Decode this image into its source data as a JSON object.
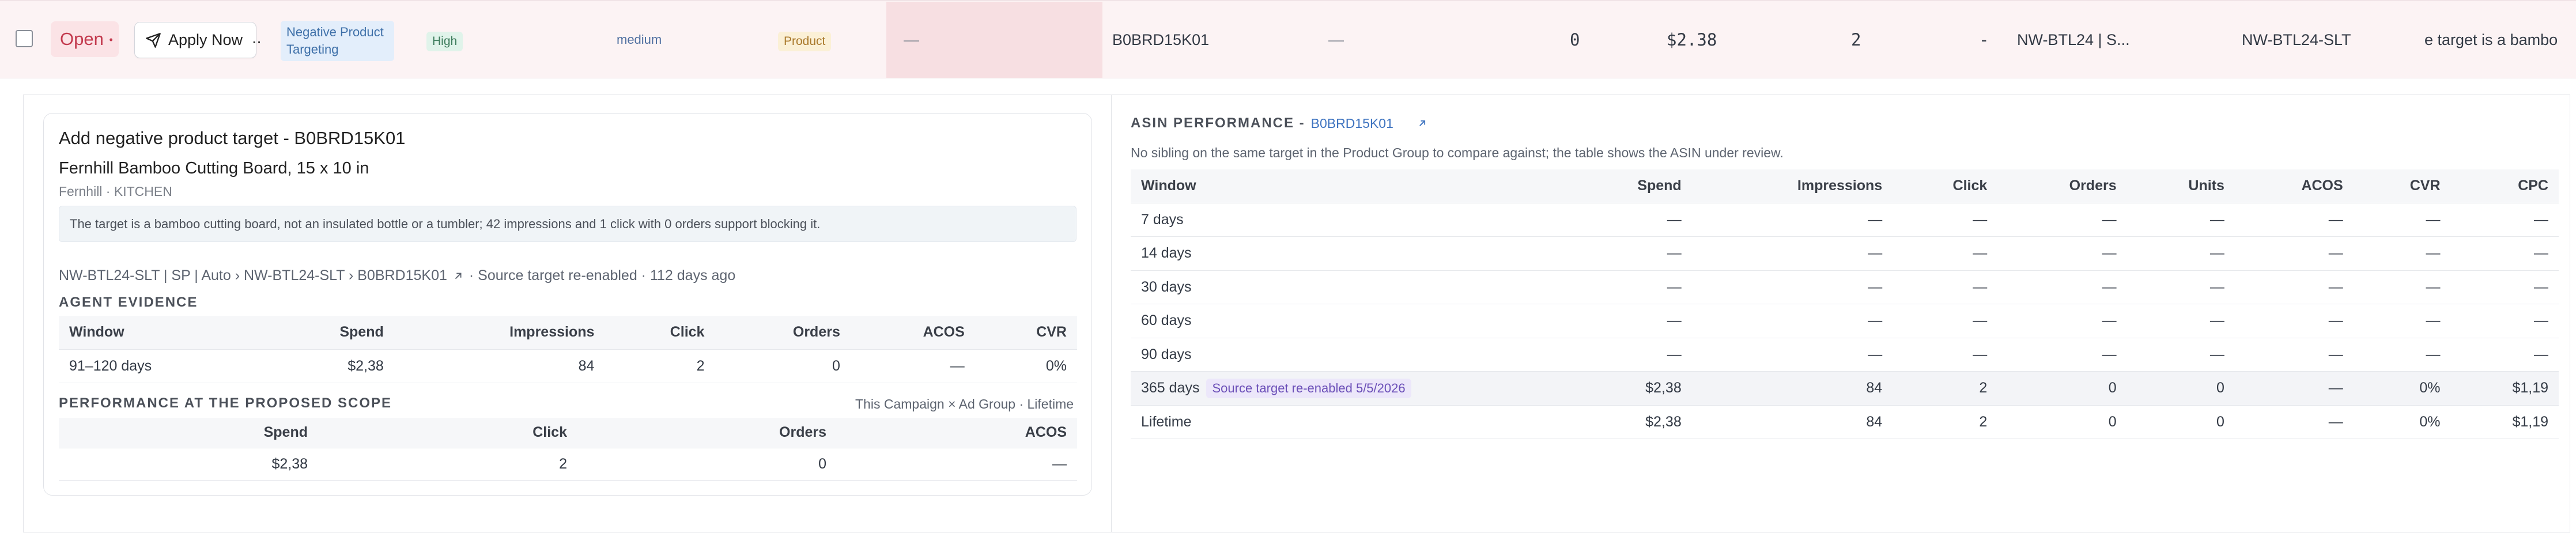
{
  "row": {
    "status": "Open",
    "status_marker": "•",
    "apply_label": "Apply Now",
    "overflow": "..",
    "type_tag": "Negative Product Targeting",
    "priority": "High",
    "confidence": "medium",
    "category": "Product",
    "dash_a": "—",
    "asin": "B0BRD15K01",
    "dash_b": "—",
    "zero": "0",
    "spend": "$2.38",
    "clicks": "2",
    "dash_c": "-",
    "campaign": "NW-BTL24 | S...",
    "ad_group": "NW-BTL24-SLT",
    "reason_clip": "e target is a bambo"
  },
  "card": {
    "title": "Add negative product target - B0BRD15K01",
    "product_name": "Fernhill Bamboo Cutting Board, 15 x 10 in",
    "brand": "Fernhill · KITCHEN",
    "reason": "The target is a bamboo cutting board, not an insulated bottle or a tumbler; 42 impressions and 1 click with 0 orders support blocking it.",
    "breadcrumb": "NW-BTL24-SLT | SP | Auto › NW-BTL24-SLT › B0BRD15K01",
    "breadcrumb_suffix": "· Source target re-enabled · 112 days ago",
    "agent_evidence_label": "AGENT EVIDENCE",
    "evidence": {
      "headers": [
        "Window",
        "Spend",
        "Impressions",
        "Click",
        "Orders",
        "ACOS",
        "CVR"
      ],
      "rows": [
        [
          "91–120 days",
          "$2,38",
          "84",
          "2",
          "0",
          "—",
          "0%"
        ]
      ]
    },
    "scope_label": "PERFORMANCE AT THE PROPOSED SCOPE",
    "scope_note": "This Campaign × Ad Group · Lifetime",
    "scope": {
      "headers": [
        "Spend",
        "Click",
        "Orders",
        "ACOS"
      ],
      "rows": [
        [
          "$2,38",
          "2",
          "0",
          "—"
        ]
      ]
    }
  },
  "asin_panel": {
    "title": "ASIN PERFORMANCE -",
    "asin_link": "B0BRD15K01",
    "note": "No sibling on the same target in the Product Group to compare against; the table shows the ASIN under review.",
    "headers": [
      "Window",
      "Spend",
      "Impressions",
      "Click",
      "Orders",
      "Units",
      "ACOS",
      "CVR",
      "CPC"
    ],
    "rows": [
      [
        "7 days",
        "—",
        "—",
        "—",
        "—",
        "—",
        "—",
        "—",
        "—"
      ],
      [
        "14 days",
        "—",
        "—",
        "—",
        "—",
        "—",
        "—",
        "—",
        "—"
      ],
      [
        "30 days",
        "—",
        "—",
        "—",
        "—",
        "—",
        "—",
        "—",
        "—"
      ],
      [
        "60 days",
        "—",
        "—",
        "—",
        "—",
        "—",
        "—",
        "—",
        "—"
      ],
      [
        "90 days",
        "—",
        "—",
        "—",
        "—",
        "—",
        "—",
        "—",
        "—"
      ],
      [
        "365 days",
        "$2,38",
        "84",
        "2",
        "0",
        "0",
        "—",
        "0%",
        "$1,19"
      ],
      [
        "Lifetime",
        "$2,38",
        "84",
        "2",
        "0",
        "0",
        "—",
        "0%",
        "$1,19"
      ]
    ],
    "source_badge": "Source target re-enabled 5/5/2026"
  },
  "colors": {
    "status_red": "#c33a4e",
    "link_blue": "#3f74c0",
    "badge_purple": "#6b4fb8"
  },
  "icons": [
    "checkbox-icon",
    "send-icon",
    "external-link-icon"
  ]
}
